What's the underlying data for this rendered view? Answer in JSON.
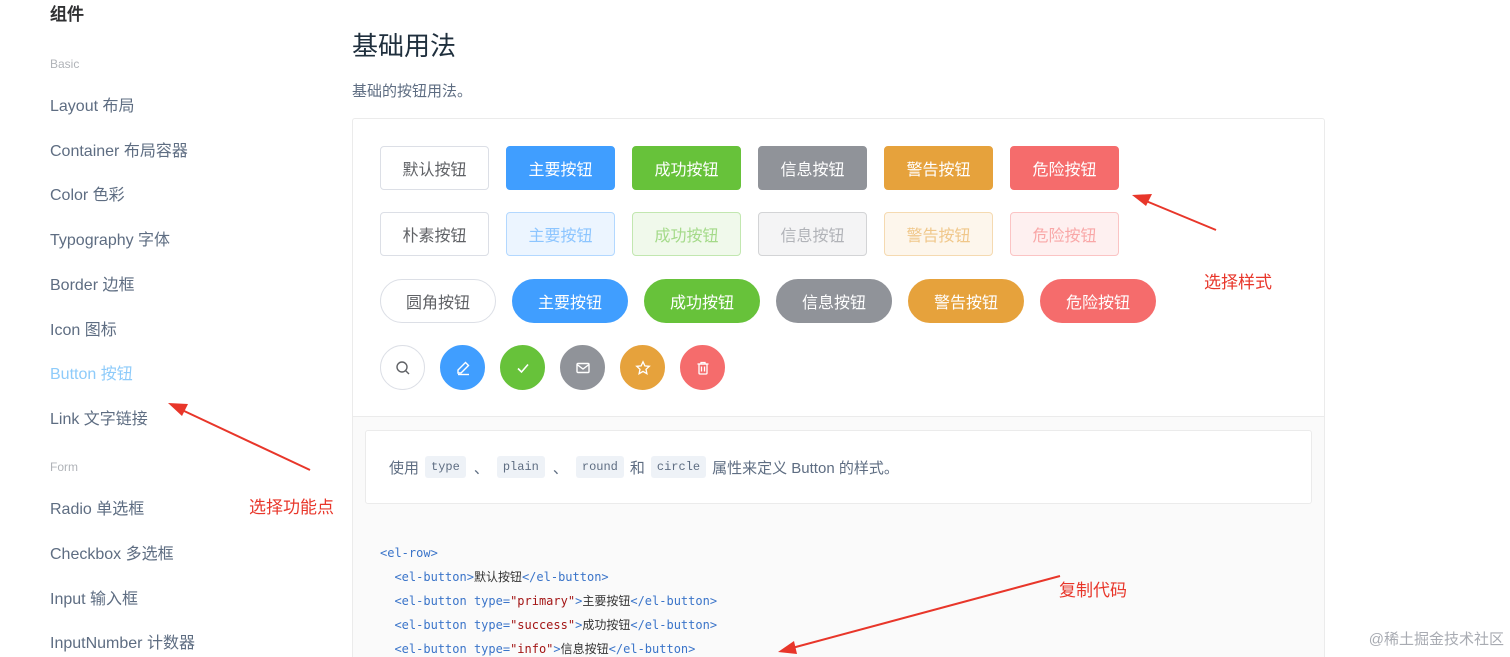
{
  "sidebar": {
    "title": "组件",
    "groups": {
      "basic": "Basic",
      "form": "Form"
    },
    "items": [
      {
        "label": "Layout 布局"
      },
      {
        "label": "Container 布局容器"
      },
      {
        "label": "Color 色彩"
      },
      {
        "label": "Typography 字体"
      },
      {
        "label": "Border 边框"
      },
      {
        "label": "Icon 图标"
      },
      {
        "label": "Button 按钮",
        "active": true
      },
      {
        "label": "Link 文字链接"
      },
      {
        "label": "Radio 单选框"
      },
      {
        "label": "Checkbox 多选框"
      },
      {
        "label": "Input 输入框"
      },
      {
        "label": "InputNumber 计数器"
      }
    ]
  },
  "main": {
    "title": "基础用法",
    "description": "基础的按钮用法。",
    "rows": {
      "basic": [
        "默认按钮",
        "主要按钮",
        "成功按钮",
        "信息按钮",
        "警告按钮",
        "危险按钮"
      ],
      "plain": [
        "朴素按钮",
        "主要按钮",
        "成功按钮",
        "信息按钮",
        "警告按钮",
        "危险按钮"
      ],
      "round": [
        "圆角按钮",
        "主要按钮",
        "成功按钮",
        "信息按钮",
        "警告按钮",
        "危险按钮"
      ],
      "circle_icons": [
        "search-icon",
        "edit-icon",
        "check-icon",
        "message-icon",
        "star-icon",
        "delete-icon"
      ]
    },
    "meta": {
      "text_prefix": "使用",
      "code_type": "type",
      "sep1": "、",
      "code_plain": "plain",
      "sep2": "、",
      "code_round": "round",
      "and": "和",
      "code_circle": "circle",
      "text_suffix": "属性来定义 Button 的样式。"
    },
    "code_lines": [
      {
        "open": "<el-row>"
      },
      {
        "open": "<el-button>",
        "text": "默认按钮",
        "close": "</el-button>"
      },
      {
        "open_tag": "<el-button ",
        "attr": "type=",
        "value": "\"primary\"",
        "gt": ">",
        "text": "主要按钮",
        "close": "</el-button>"
      },
      {
        "open_tag": "<el-button ",
        "attr": "type=",
        "value": "\"success\"",
        "gt": ">",
        "text": "成功按钮",
        "close": "</el-button>"
      },
      {
        "open_tag": "<el-button ",
        "attr": "type=",
        "value": "\"info\"",
        "gt": ">",
        "text": "信息按钮",
        "close": "</el-button>"
      }
    ]
  },
  "annotations": {
    "style": "选择样式",
    "feature": "选择功能点",
    "copy": "复制代码"
  },
  "watermark": "@稀土掘金技术社区",
  "colors": {
    "primary": "#409eff",
    "success": "#67c23a",
    "info": "#909399",
    "warning": "#e6a23c",
    "danger": "#f56c6c",
    "annotation": "#e8362a"
  }
}
